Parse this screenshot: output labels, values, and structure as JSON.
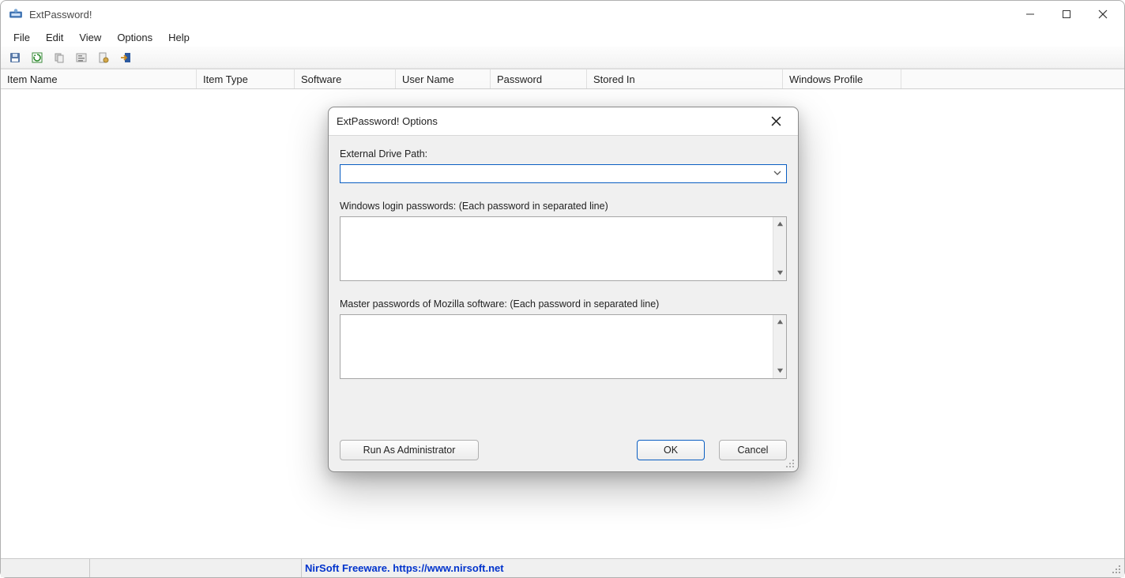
{
  "window": {
    "title": "ExtPassword!",
    "menu": {
      "file": "File",
      "edit": "Edit",
      "view": "View",
      "options": "Options",
      "help": "Help"
    }
  },
  "columns": {
    "item_name": "Item Name",
    "item_type": "Item Type",
    "software": "Software",
    "user_name": "User Name",
    "password": "Password",
    "stored_in": "Stored In",
    "windows_profile": "Windows Profile"
  },
  "statusbar": {
    "link_text": "NirSoft Freeware. https://www.nirsoft.net"
  },
  "dialog": {
    "title": "ExtPassword! Options",
    "labels": {
      "drive_path": "External Drive Path:",
      "win_login": "Windows login passwords: (Each password in separated line)",
      "mozilla": "Master passwords of Mozilla software: (Each password in separated line)"
    },
    "fields": {
      "drive_path_value": "",
      "win_login_value": "",
      "mozilla_value": ""
    },
    "buttons": {
      "run_as_admin": "Run As Administrator",
      "ok": "OK",
      "cancel": "Cancel"
    }
  }
}
